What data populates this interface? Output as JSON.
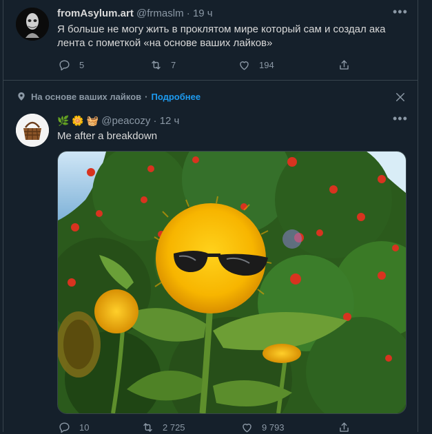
{
  "tweet1": {
    "name": "fromAsylum.art",
    "handle": "@frmaslm",
    "sep": "·",
    "time": "19 ч",
    "text_line1": "Я больше не могу жить в проклятом мире который сам и создал ака",
    "text_line2": "лента с пометкой «на основе ваших лайков»",
    "replies": "5",
    "retweets": "7",
    "likes": "194"
  },
  "context": {
    "label": "На основе ваших лайков",
    "sep": "·",
    "link": "Подробнее"
  },
  "tweet2": {
    "emojis": "🌿 🌼 🧺",
    "handle": "@peacozy",
    "sep": "·",
    "time": "12 ч",
    "text": "Me after a breakdown",
    "replies": "10",
    "retweets": "2 725",
    "likes": "9 793"
  },
  "colors": {
    "bg": "#15202b",
    "border": "#38444d",
    "muted": "#8b98a5",
    "link": "#1d9bf0"
  },
  "icons": [
    "reply-icon",
    "retweet-icon",
    "like-icon",
    "share-icon",
    "more-icon",
    "close-icon",
    "sparkle-pin-icon"
  ]
}
